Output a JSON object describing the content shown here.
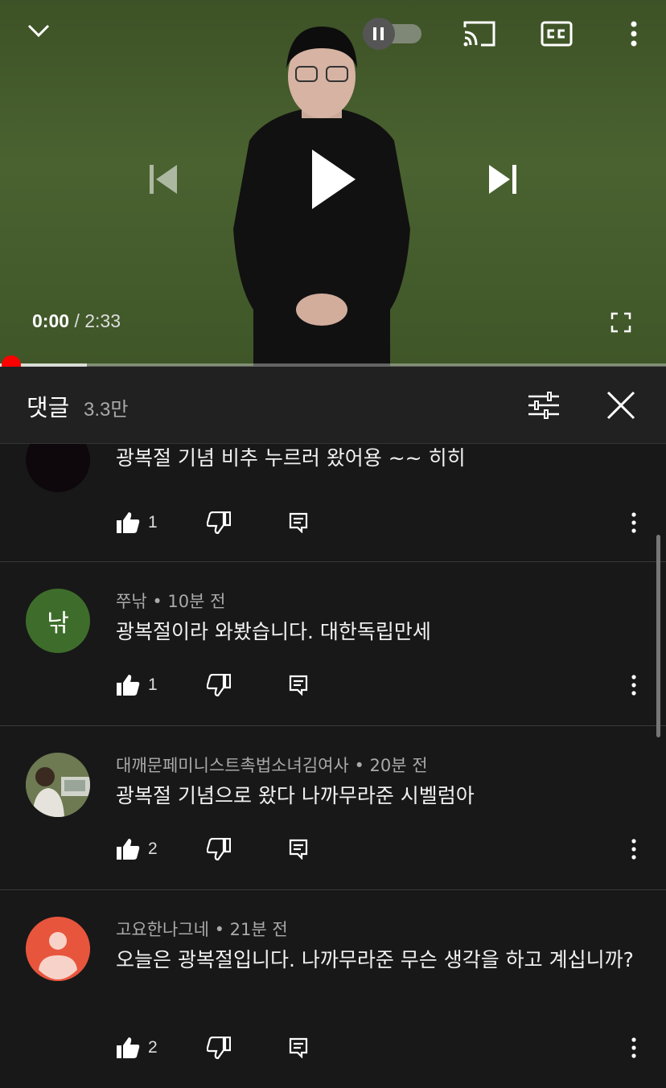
{
  "player": {
    "current_time": "0:00",
    "duration_sep": "/ 2:33",
    "progress": 0.0,
    "buffered": 0.13
  },
  "comments_panel": {
    "title": "댓글",
    "count": "3.3만"
  },
  "comments": [
    {
      "author": "",
      "time": "",
      "text": "광복절 기념 비추 누르러 왔어용 ~~ 히히",
      "likes": "1",
      "avatar_type": "dark"
    },
    {
      "author": "쭈낚",
      "time": "• 10분 전",
      "text": "광복절이라 와봤습니다. 대한독립만세",
      "likes": "1",
      "avatar_letter": "낚",
      "avatar_color": "#3e6d2b"
    },
    {
      "author": "대깨문페미니스트촉법소녀김여사",
      "time": "• 20분 전",
      "text": "광복절 기념으로 왔다 나까무라준 시벨럼아",
      "likes": "2",
      "avatar_type": "photo"
    },
    {
      "author": "고요한나그네",
      "time": "• 21분 전",
      "text": "오늘은 광복절입니다. 나까무라준 무슨 생각을 하고 계십니까?",
      "likes": "2",
      "avatar_color": "#e8553d"
    }
  ],
  "colors": {
    "progress": "#ff0000",
    "background": "#181818",
    "header": "#212121"
  }
}
